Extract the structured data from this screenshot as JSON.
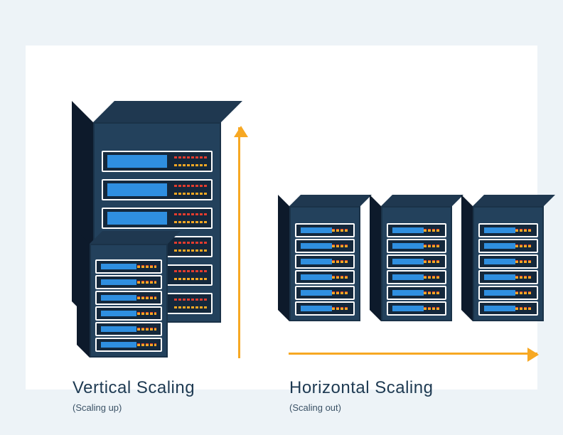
{
  "left": {
    "title": "Vertical Scaling",
    "subtitle": "(Scaling up)"
  },
  "right": {
    "title": "Horizontal Scaling",
    "subtitle": "(Scaling out)"
  }
}
